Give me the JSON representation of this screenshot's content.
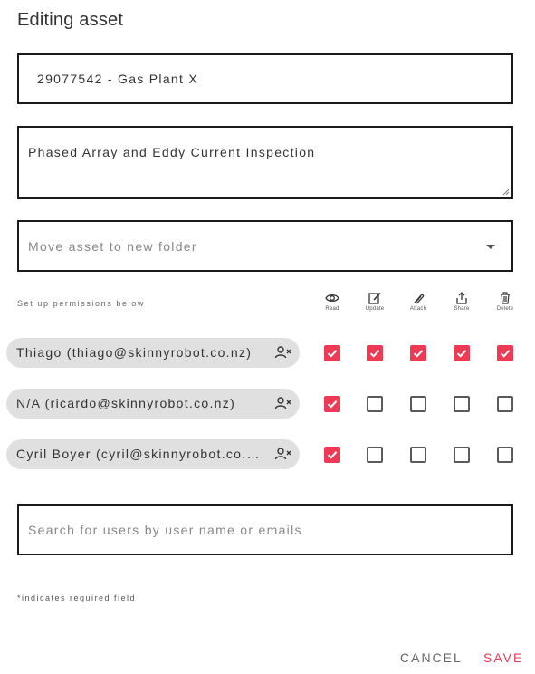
{
  "dialog": {
    "title": "Editing asset"
  },
  "asset_field": {
    "value": "29077542 - Gas Plant X"
  },
  "description_field": {
    "value": "Phased Array and Eddy Current Inspection"
  },
  "folder_select": {
    "placeholder": "Move asset to new folder"
  },
  "permissions": {
    "label": "Set up permissions below",
    "columns": [
      {
        "label": "Read",
        "icon": "eye-icon"
      },
      {
        "label": "Update",
        "icon": "edit-icon"
      },
      {
        "label": "Attach",
        "icon": "paperclip-icon"
      },
      {
        "label": "Share",
        "icon": "share-icon"
      },
      {
        "label": "Delete",
        "icon": "trash-icon"
      }
    ],
    "users": [
      {
        "display": "Thiago (thiago@skinnyrobot.co.nz)",
        "perms": [
          true,
          true,
          true,
          true,
          true
        ]
      },
      {
        "display": "N/A (ricardo@skinnyrobot.co.nz)",
        "perms": [
          true,
          false,
          false,
          false,
          false
        ]
      },
      {
        "display": "Cyril Boyer (cyril@skinnyrobot.co.nz)",
        "perms": [
          true,
          false,
          false,
          false,
          false
        ]
      }
    ]
  },
  "user_search": {
    "placeholder": "Search for users by user name or emails"
  },
  "footer": {
    "required_note": "*indicates required field",
    "cancel_label": "CANCEL",
    "save_label": "SAVE"
  },
  "colors": {
    "accent": "#ef3a56",
    "chip_bg": "#e0e0e0",
    "border": "#1a1a1a"
  }
}
